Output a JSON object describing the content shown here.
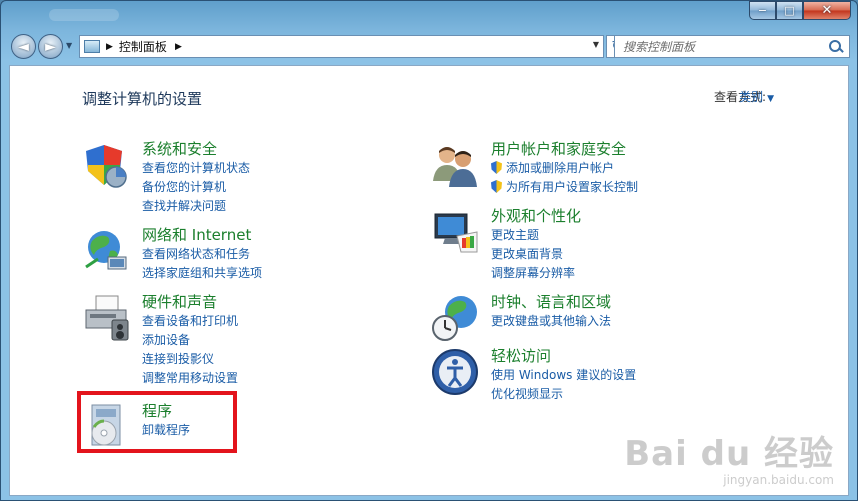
{
  "window": {
    "caption": {
      "minimize": "−",
      "maximize": "□",
      "close": "✕"
    }
  },
  "nav": {
    "back": "◄",
    "forward": "►",
    "dropdown": "▼",
    "breadcrumb": [
      "控制面板"
    ],
    "refresh": "↻"
  },
  "search": {
    "placeholder": "搜索控制面板"
  },
  "header": {
    "title": "调整计算机的设置",
    "view_by_label": "查看方式:",
    "view_by_value": "类别"
  },
  "categories": [
    {
      "title": "系统和安全",
      "icon": "system-security-icon",
      "links": [
        "查看您的计算机状态",
        "备份您的计算机",
        "查找并解决问题"
      ]
    },
    {
      "title": "网络和 Internet",
      "icon": "network-globe-icon",
      "links": [
        "查看网络状态和任务",
        "选择家庭组和共享选项"
      ]
    },
    {
      "title": "硬件和声音",
      "icon": "printer-icon",
      "links": [
        "查看设备和打印机",
        "添加设备",
        "连接到投影仪",
        "调整常用移动设置"
      ]
    },
    {
      "title": "程序",
      "icon": "programs-icon",
      "links": [
        "卸载程序"
      ]
    },
    {
      "title": "用户帐户和家庭安全",
      "icon": "users-icon",
      "links": [
        "添加或删除用户帐户",
        "为所有用户设置家长控制"
      ]
    },
    {
      "title": "外观和个性化",
      "icon": "monitor-palette-icon",
      "links": [
        "更改主题",
        "更改桌面背景",
        "调整屏幕分辨率"
      ]
    },
    {
      "title": "时钟、语言和区域",
      "icon": "clock-globe-icon",
      "links": [
        "更改键盘或其他输入法"
      ]
    },
    {
      "title": "轻松访问",
      "icon": "ease-of-access-icon",
      "links": [
        "使用 Windows 建议的设置",
        "优化视频显示"
      ]
    }
  ],
  "watermark": {
    "main": "Bai du 经验",
    "sub": "jingyan.baidu.com"
  },
  "colors": {
    "link": "#1a5ca6",
    "category_title": "#1b7f2d",
    "highlight": "#e3141c",
    "frame": "#8cc2e6"
  }
}
